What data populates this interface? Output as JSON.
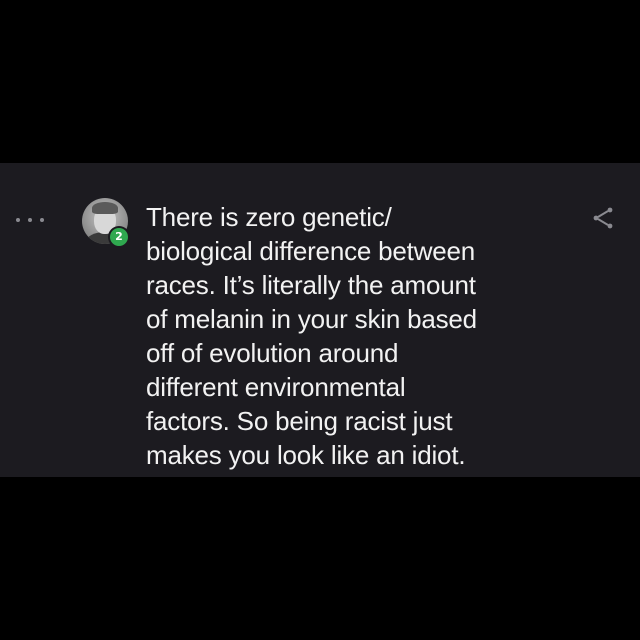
{
  "comment": {
    "text": "There is zero genetic/\nbiological difference between\nraces. It’s literally the amount\nof melanin in your skin based\noff of evolution around\ndifferent environmental\nfactors. So being racist just\nmakes you look like an idiot.",
    "avatar_badge": "2"
  },
  "icons": {
    "more": "more-dots-icon",
    "share": "share-icon"
  },
  "colors": {
    "background": "#000000",
    "card": "#1c1b20",
    "text": "#f2f2f2",
    "badge": "#2fa84f"
  }
}
